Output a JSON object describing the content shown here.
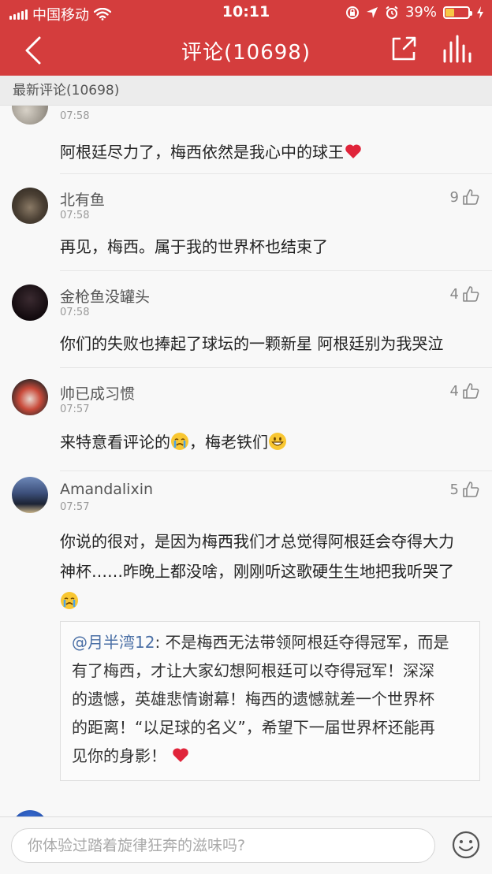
{
  "status_bar": {
    "carrier": "中国移动",
    "time": "10:11",
    "battery": "39%",
    "battery_level": 0.39
  },
  "nav": {
    "title": "评论(10698)"
  },
  "section": {
    "title": "最新评论(10698)"
  },
  "comments": [
    {
      "name": "",
      "time": "07:58",
      "likes": "",
      "text": "阿根廷尽力了，梅西依然是我心中的球王"
    },
    {
      "name": "北有鱼",
      "time": "07:58",
      "likes": "9",
      "text": "再见，梅西。属于我的世界杯也结束了"
    },
    {
      "name": "金枪鱼没罐头",
      "time": "07:58",
      "likes": "4",
      "text": "你们的失败也捧起了球坛的一颗新星 阿根廷别为我哭泣"
    },
    {
      "name": "帅已成习惯",
      "time": "07:57",
      "likes": "4",
      "text_a": "来特意看评论的",
      "text_b": "，梅老铁们"
    },
    {
      "name": "Amandalixin",
      "time": "07:57",
      "likes": "5",
      "line1": "你说的很对，是因为梅西我们才总觉得阿根廷会夺得大力",
      "line2": "神杯……昨晚上都没啥，刚刚听这歌硬生生地把我听哭了",
      "quote": {
        "name": "@月半湾12",
        "lines": [
          ": 不是梅西无法带领阿根廷夺得冠军，而是",
          "有了梅西，才让大家幻想阿根廷可以夺得冠军！深深",
          "的遗憾，英雄悲情谢幕！梅西的遗憾就差一个世界杯",
          "的距离！“以足球的名义”，希望下一届世界杯还能再",
          "见你的身影！"
        ]
      }
    }
  ],
  "input": {
    "placeholder": "你体验过踏着旋律狂奔的滋味吗?"
  },
  "colors": {
    "brand_red": "#d43d3d",
    "quote_name": "#4a6fa5"
  },
  "icons": [
    "back-arrow-icon",
    "share-icon",
    "stats-icon",
    "thumbs-up-icon",
    "smile-icon",
    "heart-emoji",
    "crying-emoji",
    "grin-emoji"
  ]
}
